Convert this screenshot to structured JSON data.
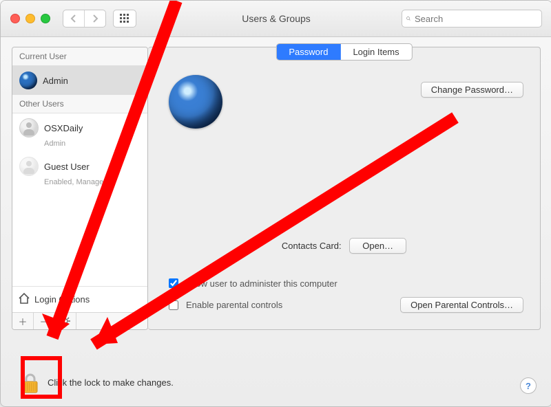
{
  "window": {
    "title": "Users & Groups"
  },
  "search": {
    "placeholder": "Search"
  },
  "sidebar": {
    "current_header": "Current User",
    "other_header": "Other Users",
    "current": {
      "name": "Admin"
    },
    "others": [
      {
        "name": "OSXDaily",
        "sub": "Admin"
      },
      {
        "name": "Guest User",
        "sub": "Enabled, Managed"
      }
    ],
    "login_options": "Login Options"
  },
  "tabs": {
    "password": "Password",
    "login_items": "Login Items"
  },
  "main": {
    "change_password": "Change Password…",
    "contacts_label": "Contacts Card:",
    "open": "Open…",
    "admin_check": "Allow user to administer this computer",
    "parental_check": "Enable parental controls",
    "open_parental": "Open Parental Controls…"
  },
  "footer": {
    "lock_text": "Click the lock to make changes."
  },
  "colors": {
    "accent": "#2e7bff",
    "annotation": "#ff0000"
  }
}
